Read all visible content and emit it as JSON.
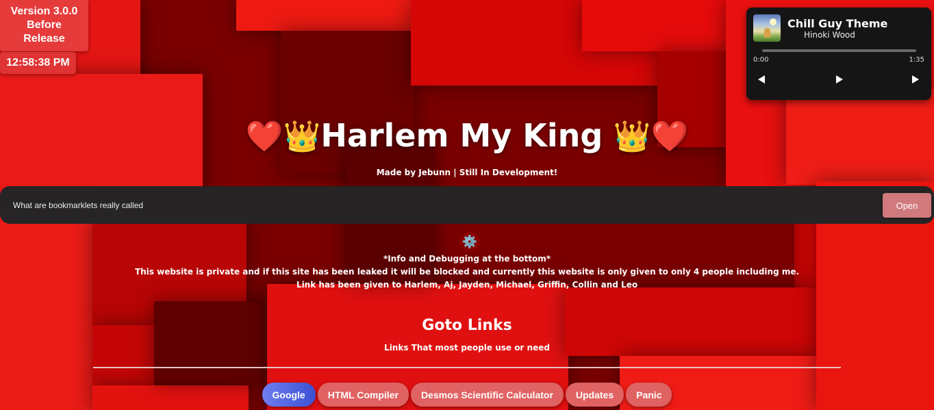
{
  "version": {
    "label_line1": "Version 3.0.0",
    "label_line2": "Before",
    "label_line3": "Release"
  },
  "clock": {
    "time": "12:58:38 PM"
  },
  "player": {
    "title": "Chill Guy Theme",
    "artist": "Hinoki Wood",
    "current_time": "0:00",
    "duration": "1:35",
    "progress": 0,
    "icons": {
      "prev": "previous-icon",
      "play": "play-icon",
      "next": "next-icon",
      "cover": "album-cover"
    }
  },
  "hero": {
    "emoji_left": "❤️👑",
    "title": "Harlem My King",
    "emoji_right": " 👑❤️",
    "subtitle": "Made by Jebunn | Still In Development!"
  },
  "search": {
    "value": "What are bookmarklets really called",
    "button_label": "Open"
  },
  "info": {
    "gear_icon": "⚙️",
    "line1": "*Info and Debugging at the bottom*",
    "line2": "This website is private and if this site has been leaked it will be blocked and currently this website is only given to only 4 people including me.",
    "line3": "Link has been given to Harlem, Aj, Jayden, Michael, Griffin, Collin and Leo"
  },
  "goto": {
    "title": "Goto Links",
    "subtitle": "Links That most people use or need",
    "links": [
      "Google",
      "HTML Compiler",
      "Desmos Scientific Calculator",
      "Updates",
      "Panic"
    ]
  },
  "colors": {
    "accent_red": "#e06262",
    "google_blue": "#4a5ee0",
    "player_bg": "#151515",
    "search_bg": "#262424",
    "open_button": "#d07a7e"
  }
}
